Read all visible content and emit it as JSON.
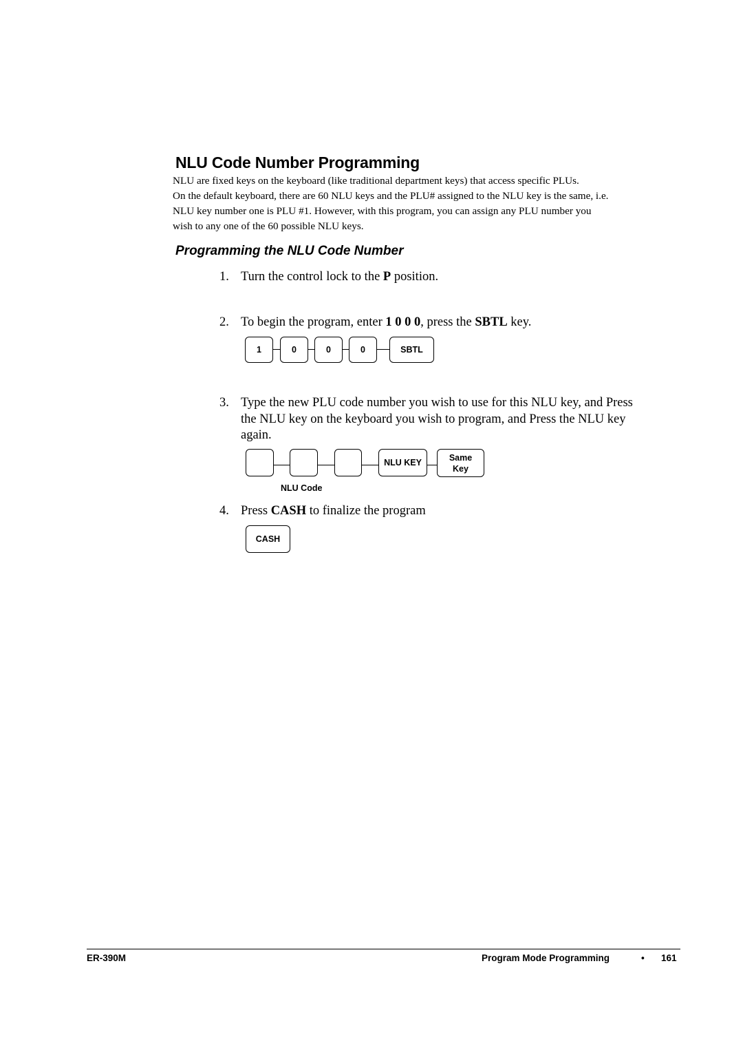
{
  "page": {
    "title": "NLU Code Number Programming",
    "intro": [
      "NLU are fixed keys on the keyboard (like traditional department keys) that access specific PLUs.",
      "On the default keyboard, there are 60 NLU keys and the PLU# assigned to the NLU key is the same, i.e.",
      "NLU key number one is PLU #1. However, with this program, you can assign any PLU number you",
      "wish to any one of the 60 possible NLU keys."
    ],
    "subtitle": "Programming the NLU Code Number"
  },
  "steps": [
    {
      "number": "1.",
      "pre": "Turn the control lock to the ",
      "bold": "P",
      "post": " position."
    },
    {
      "number": "2.",
      "pre": "To begin the program, enter ",
      "bold": "1 0 0 0",
      "mid": ", press the ",
      "bold2": "SBTL",
      "post": " key."
    },
    {
      "number": "3.",
      "lines": [
        "Type the new PLU code number you wish to use for this NLU key, and Press",
        "the NLU key on the keyboard you wish to program, and Press the NLU key",
        "again."
      ]
    },
    {
      "number": "4.",
      "pre": "Press ",
      "bold": "CASH",
      "post": " to finalize the program"
    }
  ],
  "diagrams": {
    "step2_keys": [
      "1",
      "0",
      "0",
      "0",
      "SBTL"
    ],
    "step3_keys": [
      "",
      "",
      "",
      "NLU KEY",
      "Same\nKey"
    ],
    "step3_same_key_lines": [
      "Same",
      "Key"
    ],
    "step3_caption": "NLU Code",
    "step4_keys": [
      "CASH"
    ]
  },
  "footer": {
    "model": "ER-390M",
    "section": "Program Mode Programming",
    "bullet": "•",
    "page_number": "161"
  }
}
